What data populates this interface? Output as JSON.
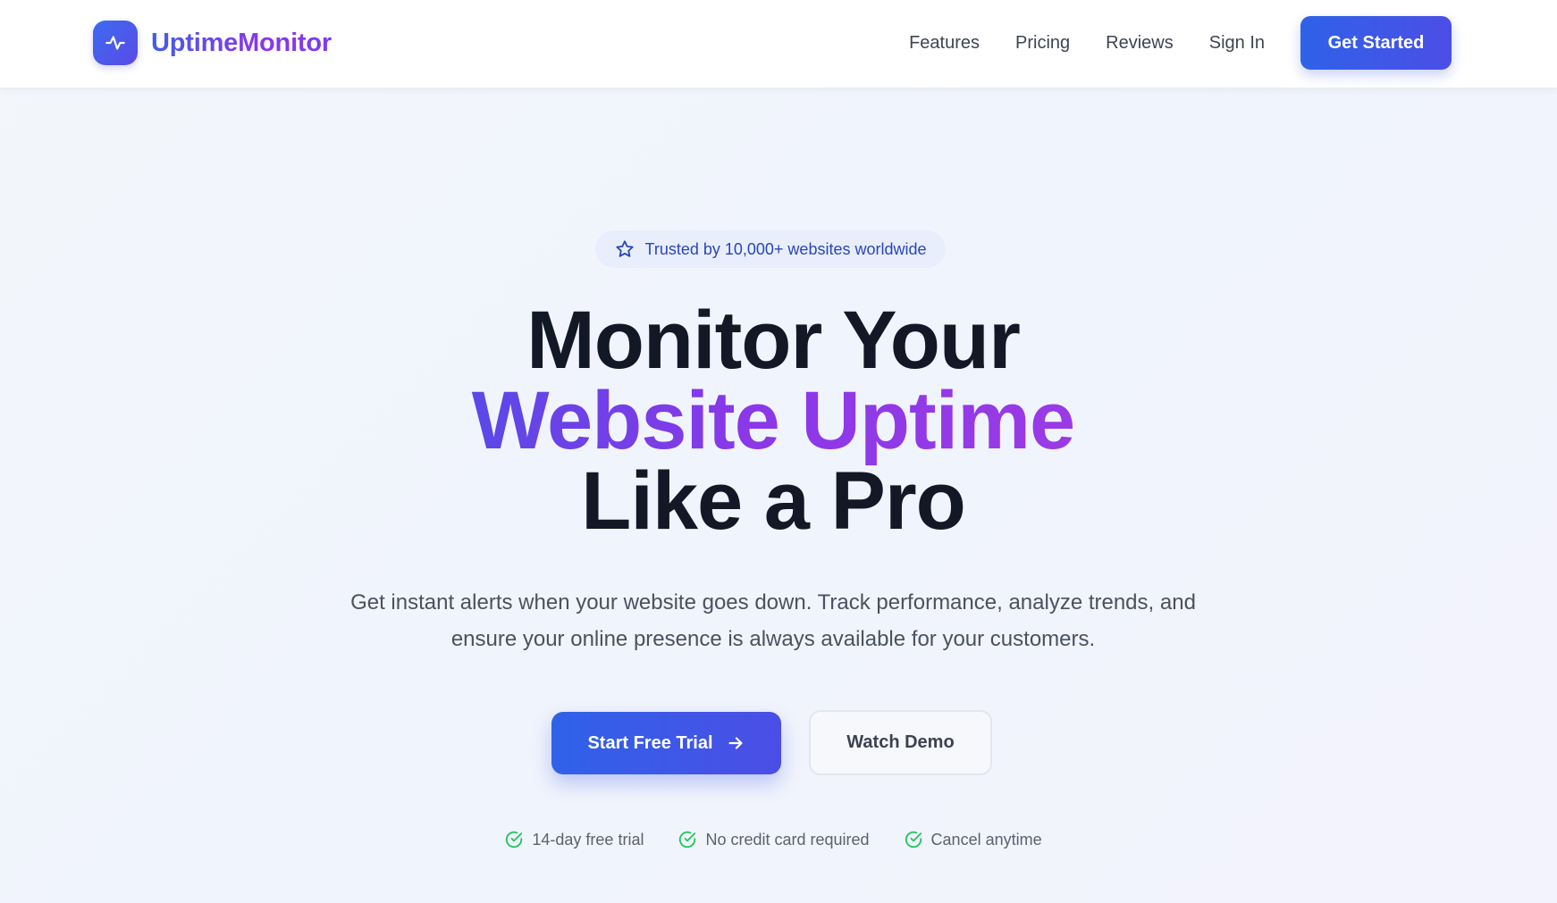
{
  "header": {
    "brand": "UptimeMonitor",
    "nav_links": [
      "Features",
      "Pricing",
      "Reviews",
      "Sign In"
    ],
    "cta_label": "Get Started"
  },
  "hero": {
    "badge_text": "Trusted by 10,000+ websites worldwide",
    "headline_line1": "Monitor Your",
    "headline_line2": "Website Uptime",
    "headline_line3": "Like a Pro",
    "subtext": "Get instant alerts when your website goes down. Track performance, analyze trends, and ensure your online presence is always available for your customers.",
    "primary_cta": "Start Free Trial",
    "secondary_cta": "Watch Demo",
    "perks": [
      "14-day free trial",
      "No credit card required",
      "Cancel anytime"
    ]
  },
  "icons": {
    "logo": "activity-pulse-icon",
    "badge": "star-icon",
    "primary_cta": "arrow-right-icon",
    "perks": "check-circle-icon"
  },
  "colors": {
    "brand_blue": "#2f62e8",
    "brand_purple": "#8a38e8",
    "heading": "#121826",
    "check_green": "#22c55e",
    "badge_text": "#2a46b8"
  }
}
